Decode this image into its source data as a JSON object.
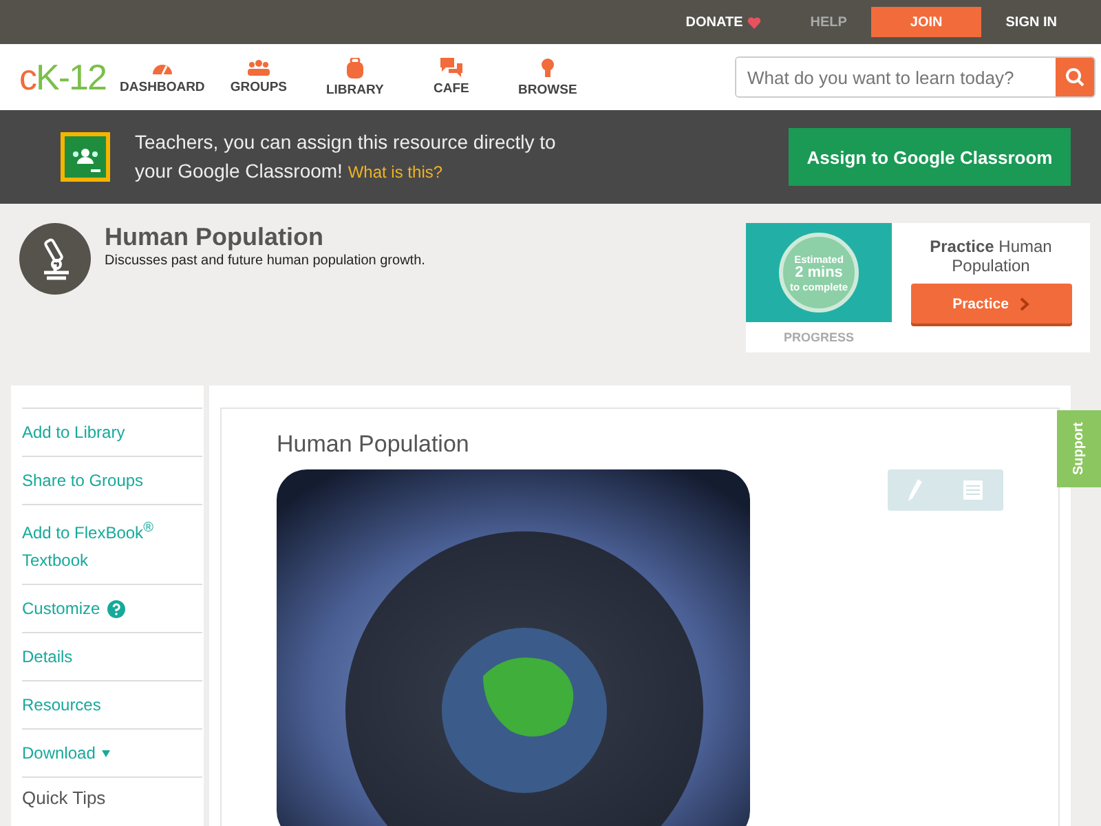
{
  "top_bar": {
    "links": [
      {
        "label": "DONATE",
        "kind": "donate"
      },
      {
        "label": "HELP",
        "kind": "muted"
      },
      {
        "label": "JOIN",
        "kind": "primary"
      },
      {
        "label": "SIGN IN",
        "kind": "plain"
      }
    ]
  },
  "nav": {
    "logo": "cK-12",
    "items": [
      {
        "label": "DASHBOARD",
        "kind": "gauge"
      },
      {
        "label": "GROUPS",
        "kind": "people"
      },
      {
        "label": "LIBRARY",
        "kind": "backpack"
      },
      {
        "label": "CAFE",
        "kind": "chat"
      },
      {
        "label": "BROWSE",
        "kind": "bulb"
      }
    ],
    "search": {
      "placeholder": "What do you want to learn today?"
    }
  },
  "banner": {
    "text": "Teachers, you can assign this resource directly to your Google Classroom!",
    "link": "What is this?",
    "button": "Assign to Google Classroom"
  },
  "header": {
    "title": "Human Population",
    "subtitle": "Discusses past and future human population growth.",
    "practice": {
      "estimate": [
        "Estimated",
        "2 mins",
        "to complete"
      ],
      "progress": "PROGRESS",
      "title": "**Practice** Human Population",
      "button": "Practice"
    }
  },
  "sidebar": {
    "items": [
      {
        "label": "Add to Library",
        "kind": "link"
      },
      {
        "label": "Share to Groups",
        "kind": "link"
      },
      {
        "label": "Add to FlexBook$^{®}$ Textbook",
        "kind": "link"
      },
      {
        "label": "Customize",
        "kind": "help"
      },
      {
        "label": "Details",
        "kind": "link"
      },
      {
        "label": "Resources",
        "kind": "link"
      },
      {
        "label": "Download",
        "kind": "dropdown"
      },
      {
        "label": "Quick Tips",
        "kind": "heading"
      }
    ]
  },
  "main": {
    "title": "Human Population"
  },
  "support_tab": "Support"
}
